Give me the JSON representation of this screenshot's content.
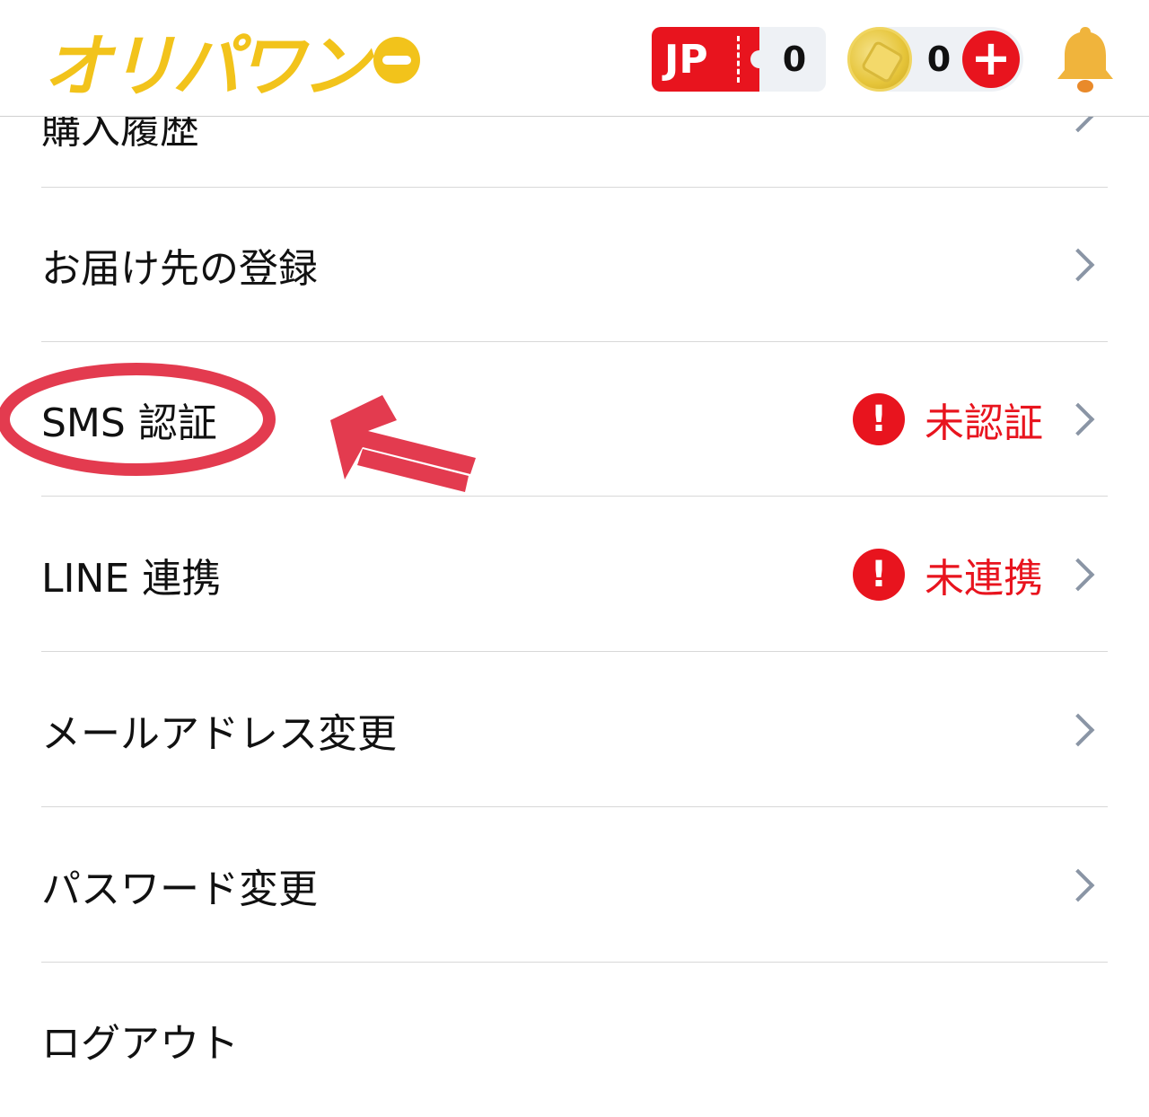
{
  "header": {
    "logo_text": "オリパワン",
    "jp_label": "JP",
    "jp_count": "0",
    "coin_count": "0",
    "plus_label": "+"
  },
  "partial_row": {
    "label": "購入履歴"
  },
  "menu": {
    "items": [
      {
        "label": "お届け先の登録",
        "status": ""
      },
      {
        "label": "SMS 認証",
        "status": "未認証"
      },
      {
        "label": "LINE 連携",
        "status": "未連携"
      },
      {
        "label": "メールアドレス変更",
        "status": ""
      },
      {
        "label": "パスワード変更",
        "status": ""
      },
      {
        "label": "ログアウト",
        "status": ""
      }
    ]
  },
  "warn_symbol": "!",
  "colors": {
    "brand_yellow": "#f2c31b",
    "alert_red": "#e8141e",
    "annotation_red": "#e33b4f",
    "chevron_gray": "#8a95a5"
  }
}
